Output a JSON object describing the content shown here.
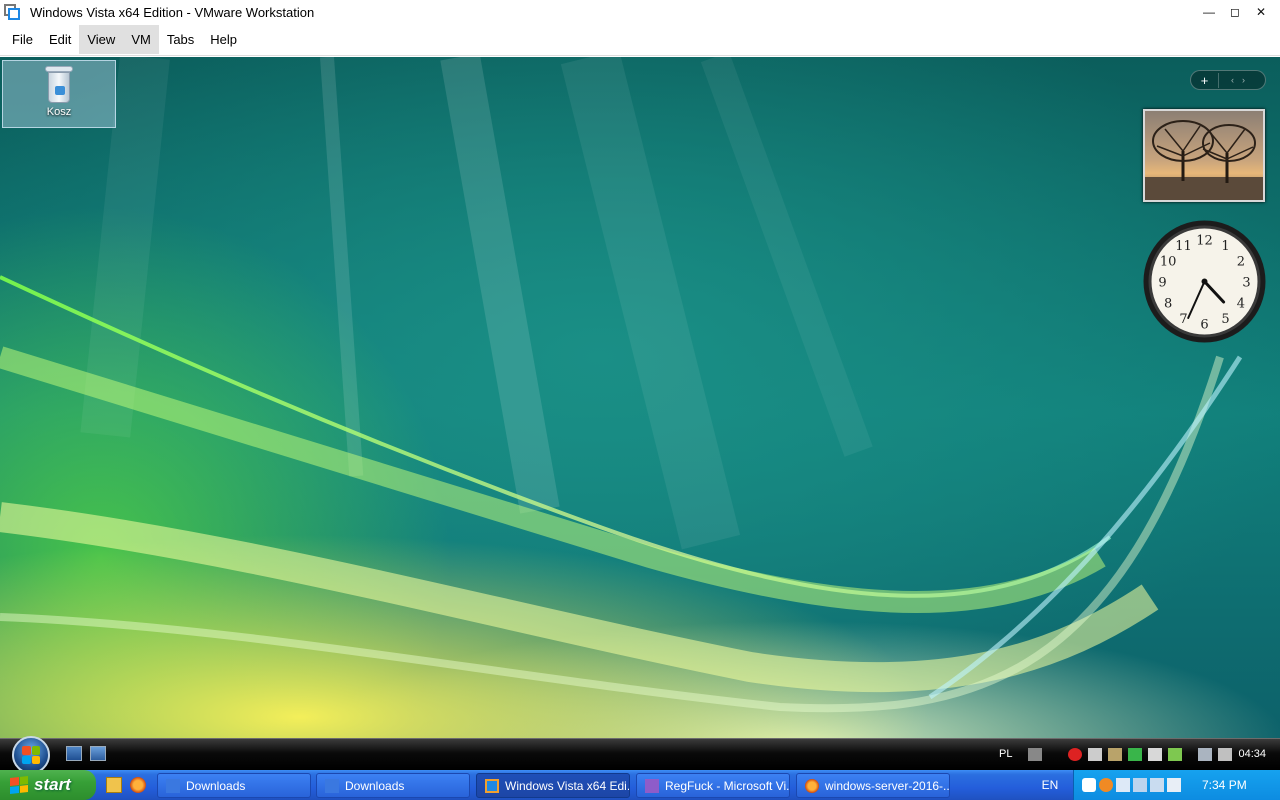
{
  "window": {
    "title": "Windows Vista x64 Edition - VMware Workstation",
    "minimize_icon": "minimize-icon",
    "maximize_icon": "maximize-icon",
    "close_icon": "close-icon"
  },
  "menubar": {
    "items": [
      "File",
      "Edit",
      "View",
      "VM",
      "Tabs",
      "Help"
    ],
    "active": [
      "View",
      "VM"
    ]
  },
  "vm_desktop": {
    "icons": [
      {
        "label": "Kosz",
        "icon": "recycle-bin-icon"
      }
    ],
    "gadget_controls": {
      "add": "+",
      "prev": "‹",
      "next": "›"
    },
    "gadgets": [
      "slideshow",
      "clock"
    ],
    "clock": {
      "hour": 4,
      "minute": 34
    }
  },
  "vista_taskbar": {
    "quick_launch": [
      "show-desktop-icon",
      "switch-windows-icon"
    ],
    "tray": {
      "language": "PL",
      "time": "04:34"
    }
  },
  "host_taskbar": {
    "start_label": "start",
    "quick_launch": [
      "explorer-icon",
      "firefox-icon"
    ],
    "tasks": [
      {
        "label": "Downloads",
        "icon": "folder-icon"
      },
      {
        "label": "Downloads",
        "icon": "folder-icon"
      },
      {
        "label": "Windows Vista x64 Edi...",
        "icon": "vmware-icon",
        "active": true
      },
      {
        "label": "RegFuck - Microsoft Vi...",
        "icon": "visual-studio-icon"
      },
      {
        "label": "windows-server-2016-...",
        "icon": "firefox-icon"
      }
    ],
    "language": "EN",
    "time": "7:34 PM"
  },
  "colors": {
    "xp_taskbar": "#245edb",
    "xp_start": "#37a037",
    "xp_tray": "#0d8ce1",
    "vmware_accent": "#1e88e5"
  }
}
